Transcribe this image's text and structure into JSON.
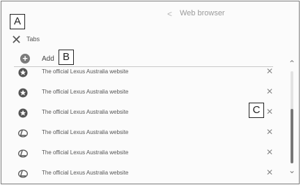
{
  "callouts": {
    "a": "A",
    "b": "B",
    "c": "C"
  },
  "header": {
    "back_glyph": "<",
    "title": "Web browser"
  },
  "close_glyph": "✕",
  "tabs_label": "Tabs",
  "add": {
    "glyph": "+",
    "label": "Add"
  },
  "rows": [
    {
      "text": "The official Lexus Australia website",
      "icon": "star-icon",
      "close": "✕"
    },
    {
      "text": "The official Lexus Australia website",
      "icon": "star-icon",
      "close": "✕"
    },
    {
      "text": "The official Lexus Australia website",
      "icon": "star-icon",
      "close": "✕"
    },
    {
      "text": "The official Lexus Australia website",
      "icon": "lexus-logo-icon",
      "close": "✕"
    },
    {
      "text": "The official Lexus Australia website",
      "icon": "lexus-logo-icon",
      "close": "✕"
    },
    {
      "text": "The official Lexus Australia website",
      "icon": "lexus-logo-icon",
      "close": "✕"
    }
  ],
  "scroll": {
    "up": "⌃",
    "down": "⌄",
    "position": 0.7
  },
  "colors": {
    "icon": "#555555",
    "text": "#555555",
    "thumb": "#777777"
  }
}
